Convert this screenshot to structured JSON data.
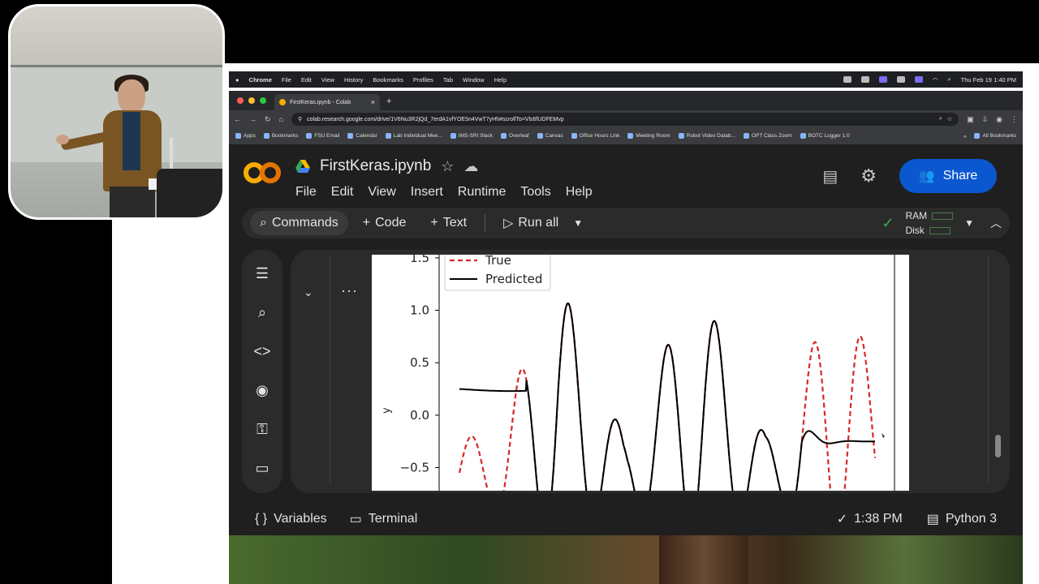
{
  "menubar": {
    "app": "Chrome",
    "items": [
      "File",
      "Edit",
      "View",
      "History",
      "Bookmarks",
      "Profiles",
      "Tab",
      "Window",
      "Help"
    ],
    "clock": "Thu Feb 19  1:40 PM"
  },
  "browser": {
    "tab_title": "FirstKeras.ipynb - Colab",
    "tab_close": "×",
    "new_tab": "+",
    "url": "colab.research.google.com/drive/1V6Nu3R2jQd_7erdA1vfYOE5n4VwT7yHh#scrollTo=Vls6fUDFEMvp",
    "bookmarks": [
      "Apps",
      "Bookmarks",
      "FSU Email",
      "Calendar",
      "Lab Individual Mee...",
      "IMS-SRI Slack",
      "Overleaf",
      "Canvas",
      "Office Hours Link",
      "Meeting Room",
      "Robot Video Datab...",
      "OPT Class Zoom",
      "BOTC Logger 1.0"
    ],
    "bookmarks_more": "»",
    "all_bookmarks": "All Bookmarks"
  },
  "colab": {
    "logo": "CO",
    "filename": "FirstKeras.ipynb",
    "menu": [
      "File",
      "Edit",
      "View",
      "Insert",
      "Runtime",
      "Tools",
      "Help"
    ],
    "share_label": "Share",
    "toolbar": {
      "commands": "Commands",
      "code": "Code",
      "text": "Text",
      "run_all": "Run all",
      "ram": "RAM",
      "disk": "Disk"
    },
    "status": {
      "variables": "Variables",
      "terminal": "Terminal",
      "time": "1:38 PM",
      "runtime": "Python 3"
    }
  },
  "chart_data": {
    "type": "line",
    "ylabel": "y",
    "y_ticks": [
      1.5,
      1.0,
      0.5,
      0.0,
      -0.5
    ],
    "y_tick_labels": [
      "1.5",
      "1.0",
      "0.5",
      "0.0",
      "−0.5"
    ],
    "y_visible_range": [
      -0.72,
      1.53
    ],
    "legend_position": "upper-left",
    "series": [
      {
        "name": "True",
        "style": "dashed",
        "color": "#d62728"
      },
      {
        "name": "Predicted",
        "style": "solid",
        "color": "#000000"
      }
    ]
  },
  "colors": {
    "accent": "#0b57d0",
    "logo_orange": "#f9ab00",
    "logo_dark_orange": "#e37400",
    "check_green": "#34a853"
  }
}
